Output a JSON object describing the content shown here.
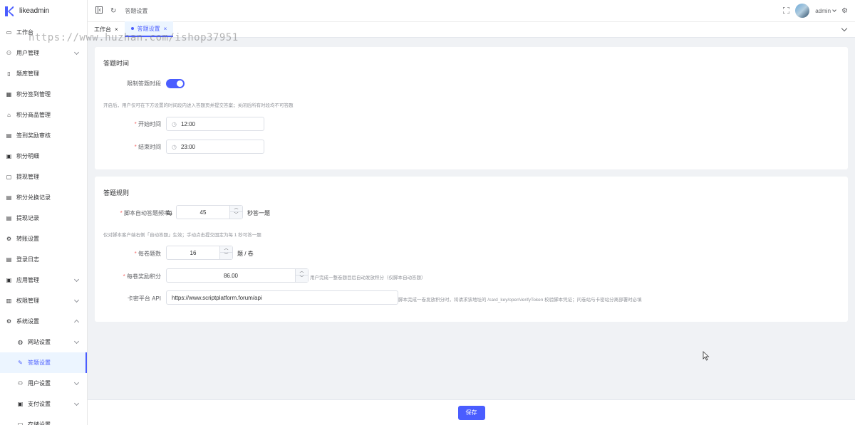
{
  "app": {
    "name": "likeadmin"
  },
  "colors": {
    "accent": "#4a5dff",
    "required": "#f56c6c"
  },
  "sidebar": {
    "items": [
      {
        "label": "工作台",
        "icon": "monitor-icon"
      },
      {
        "label": "用户管理",
        "icon": "user-icon",
        "expandable": true
      },
      {
        "label": "题库管理",
        "icon": "book-icon"
      },
      {
        "label": "积分签到管理",
        "icon": "calendar-icon"
      },
      {
        "label": "积分商品管理",
        "icon": "shop-icon"
      },
      {
        "label": "签到奖励审核",
        "icon": "clipboard-icon"
      },
      {
        "label": "积分明细",
        "icon": "wallet-icon"
      },
      {
        "label": "提现管理",
        "icon": "folder-icon"
      },
      {
        "label": "积分兑换记录",
        "icon": "clipboard-icon"
      },
      {
        "label": "提现记录",
        "icon": "clipboard-icon"
      },
      {
        "label": "转账设置",
        "icon": "gear-icon"
      },
      {
        "label": "登录日志",
        "icon": "document-icon"
      },
      {
        "label": "应用管理",
        "icon": "app-icon",
        "expandable": true
      },
      {
        "label": "权限管理",
        "icon": "lock-icon",
        "expandable": true
      },
      {
        "label": "系统设置",
        "icon": "gear-icon",
        "expandable": true,
        "expanded": true
      }
    ],
    "subitems": [
      {
        "label": "网站设置",
        "icon": "globe-icon",
        "expandable": true
      },
      {
        "label": "答题设置",
        "icon": "edit-icon",
        "active": true
      },
      {
        "label": "用户设置",
        "icon": "user-settings-icon",
        "expandable": true
      },
      {
        "label": "支付设置",
        "icon": "wallet-icon",
        "expandable": true
      },
      {
        "label": "存储设置",
        "icon": "folder-icon"
      }
    ]
  },
  "header": {
    "breadcrumb": "答题设置",
    "user": "admin"
  },
  "tabs": [
    {
      "label": "工作台",
      "close": "×"
    },
    {
      "label": "答题设置",
      "close": "×",
      "active": true
    }
  ],
  "watermark": "https://www.huzhan.com/ishop37951",
  "section_time": {
    "title": "答题时间",
    "limit_label": "限制答题时段",
    "limit_enabled": true,
    "tip": "开启后，用户仅可在下方设置的时间段内进入答题页并提交答案；关闭后所有时段均不可答题",
    "start_label": "开始时间",
    "start_value": "12:00",
    "end_label": "结束时间",
    "end_value": "23:00"
  },
  "section_rules": {
    "title": "答题规则",
    "freq_label": "脚本自动答题频率",
    "freq_prefix": "每",
    "freq_value": "45",
    "freq_suffix": "秒答一题",
    "freq_tip": "仅对脚本客户端右侧「自动答题」生效；手动点击提交固定为每 1 秒可答一题",
    "count_label": "每卷题数",
    "count_value": "16",
    "count_suffix": "题 / 卷",
    "reward_label": "每卷奖励积分",
    "reward_value": "86.00",
    "reward_tip": "用户完成一整卷题目后自动发放积分（仅脚本自动答题）",
    "api_label": "卡密平台 API",
    "api_value": "https://www.scriptplatform.forum/api",
    "api_tip": "脚本完成一卷发放积分时，将请求该地址的 /card_key/openVerifyToken 校验脚本凭证；问卷站与卡密站分离部署时必填"
  },
  "footer": {
    "save_label": "保存"
  }
}
